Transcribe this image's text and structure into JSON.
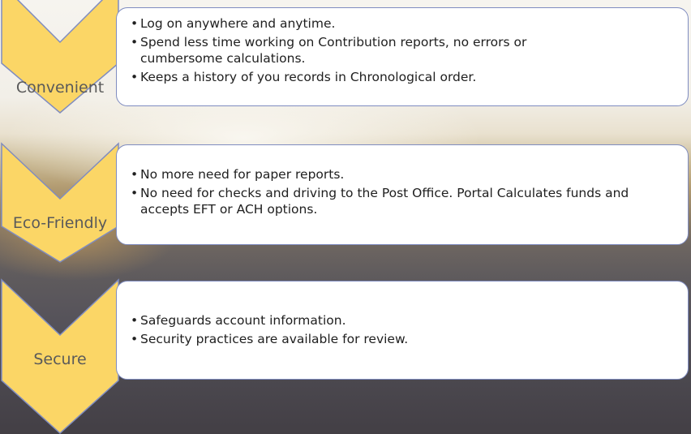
{
  "colors": {
    "chevron_fill": "#fbd666",
    "chevron_stroke": "#7f8cc0",
    "box_stroke": "#7f8cc0"
  },
  "stages": [
    {
      "label": "Convenient",
      "bullets": [
        "Log on anywhere and anytime.",
        "Spend less time working on Contribution reports, no errors or cumbersome calculations.",
        "Keeps a history of you records in Chronological order."
      ]
    },
    {
      "label": "Eco-Friendly",
      "bullets": [
        "No more need for paper reports.",
        "No need for checks and driving to the Post Office. Portal Calculates funds and accepts EFT or ACH options."
      ]
    },
    {
      "label": "Secure",
      "bullets": [
        "Safeguards account information.",
        "Security practices are available for review."
      ]
    }
  ]
}
